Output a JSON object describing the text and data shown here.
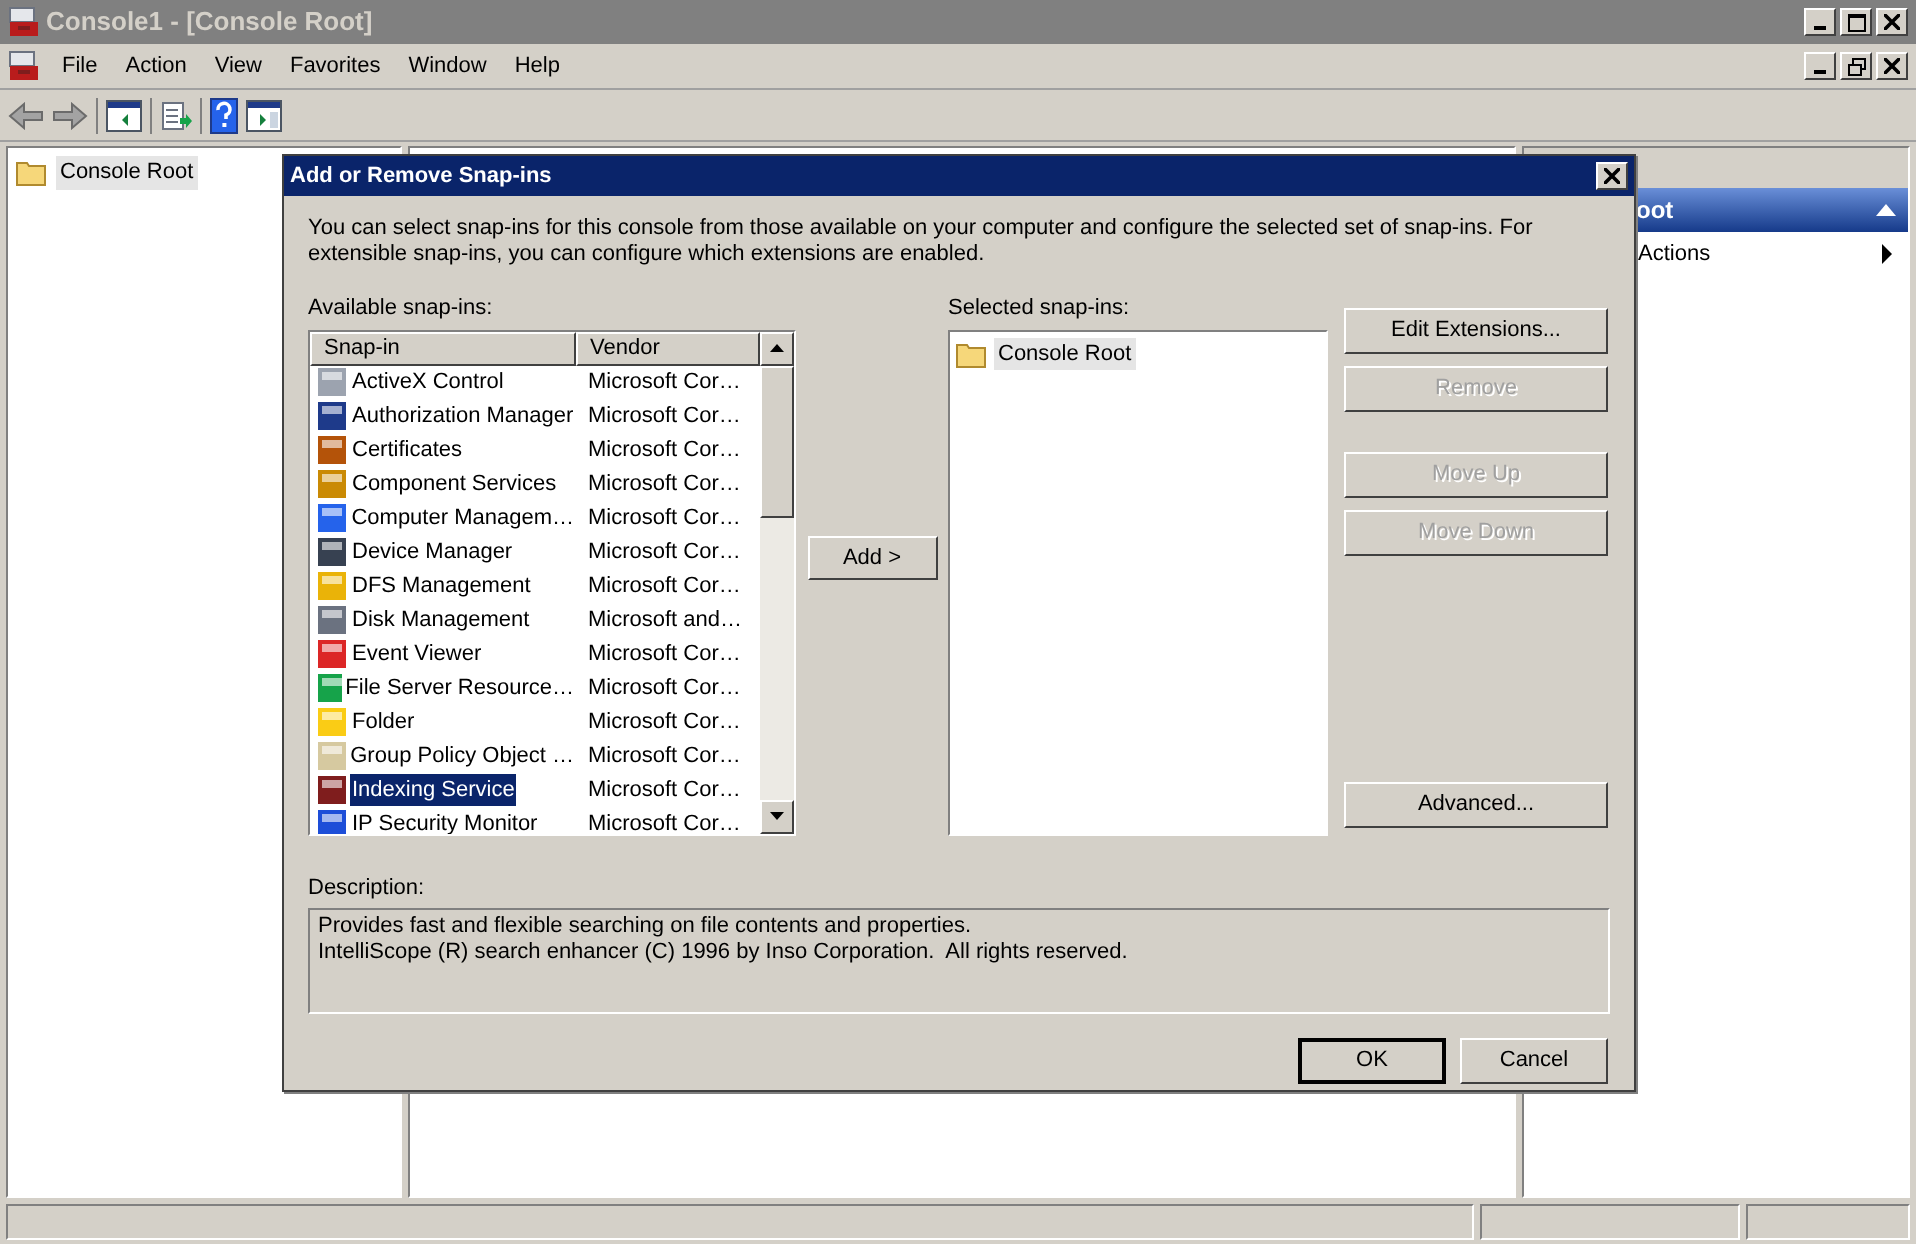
{
  "window": {
    "title": "Console1 - [Console Root]"
  },
  "menu": [
    "File",
    "Action",
    "View",
    "Favorites",
    "Window",
    "Help"
  ],
  "tree": [
    {
      "label": "Console Root",
      "selected": true
    }
  ],
  "actions_pane": {
    "header": "oot",
    "items": [
      "Actions"
    ]
  },
  "dialog": {
    "title": "Add or Remove Snap-ins",
    "intro": "You can select snap-ins for this console from those available on your computer and configure the selected set of snap-ins. For extensible snap-ins, you can configure which extensions are enabled.",
    "available_label": "Available snap-ins:",
    "columns": [
      "Snap-in",
      "Vendor"
    ],
    "snapins": [
      {
        "name": "ActiveX Control",
        "vendor": "Microsoft Cor…",
        "selected": false,
        "color": "#9ca3af"
      },
      {
        "name": "Authorization Manager",
        "vendor": "Microsoft Cor…",
        "selected": false,
        "color": "#1e3a8a"
      },
      {
        "name": "Certificates",
        "vendor": "Microsoft Cor…",
        "selected": false,
        "color": "#b45309"
      },
      {
        "name": "Component Services",
        "vendor": "Microsoft Cor…",
        "selected": false,
        "color": "#ca8a04"
      },
      {
        "name": "Computer Managem…",
        "vendor": "Microsoft Cor…",
        "selected": false,
        "color": "#2563eb"
      },
      {
        "name": "Device Manager",
        "vendor": "Microsoft Cor…",
        "selected": false,
        "color": "#374151"
      },
      {
        "name": "DFS Management",
        "vendor": "Microsoft Cor…",
        "selected": false,
        "color": "#eab308"
      },
      {
        "name": "Disk Management",
        "vendor": "Microsoft and…",
        "selected": false,
        "color": "#6b7280"
      },
      {
        "name": "Event Viewer",
        "vendor": "Microsoft Cor…",
        "selected": false,
        "color": "#dc2626"
      },
      {
        "name": "File Server Resource…",
        "vendor": "Microsoft Cor…",
        "selected": false,
        "color": "#16a34a"
      },
      {
        "name": "Folder",
        "vendor": "Microsoft Cor…",
        "selected": false,
        "color": "#facc15"
      },
      {
        "name": "Group Policy Object …",
        "vendor": "Microsoft Cor…",
        "selected": false,
        "color": "#d6c9a0"
      },
      {
        "name": "Indexing Service",
        "vendor": "Microsoft Cor…",
        "selected": true,
        "color": "#7f1d1d"
      },
      {
        "name": "IP Security Monitor",
        "vendor": "Microsoft Cor…",
        "selected": false,
        "color": "#1d4ed8"
      }
    ],
    "add_button": "Add >",
    "selected_label": "Selected snap-ins:",
    "selected_snapins": [
      {
        "name": "Console Root",
        "selected": true
      }
    ],
    "side_buttons": [
      {
        "label": "Edit Extensions...",
        "disabled": false
      },
      {
        "label": "Remove",
        "disabled": true
      },
      {
        "label": "Move Up",
        "disabled": true
      },
      {
        "label": "Move Down",
        "disabled": true
      },
      {
        "label": "Advanced...",
        "disabled": false
      }
    ],
    "description_label": "Description:",
    "description": [
      "Provides fast and flexible searching on file contents and properties.",
      "IntelliScope (R) search enhancer (C) 1996 by Inso Corporation.  All rights reserved."
    ],
    "buttons": [
      {
        "label": "OK",
        "default": true
      },
      {
        "label": "Cancel",
        "default": false
      }
    ]
  }
}
